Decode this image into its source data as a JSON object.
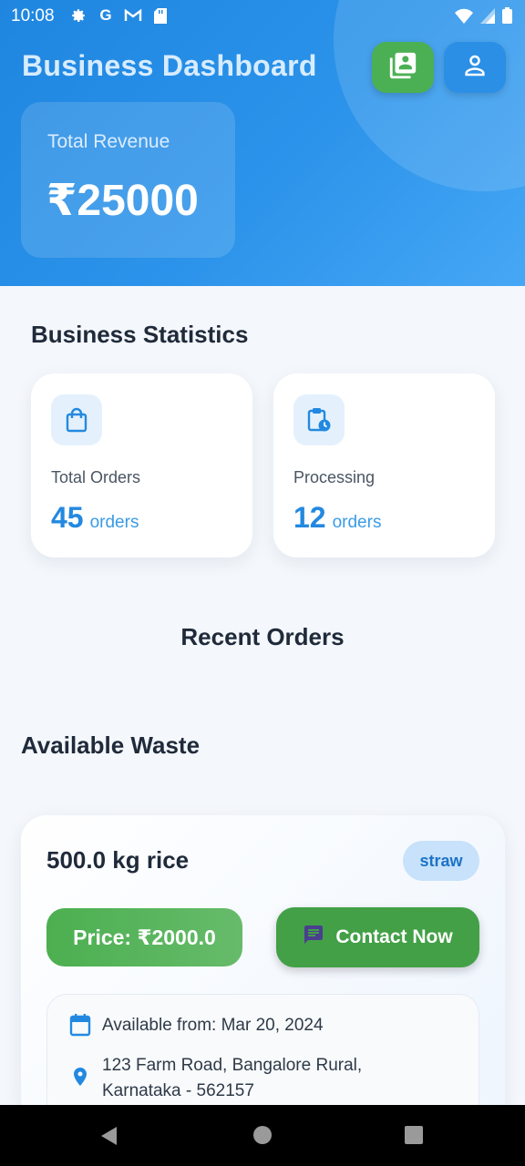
{
  "status_bar": {
    "time": "10:08",
    "icons": [
      "settings-icon",
      "google-icon",
      "gmail-icon",
      "sd-card-icon"
    ],
    "right_icons": [
      "wifi-icon",
      "signal-icon",
      "battery-icon"
    ]
  },
  "header": {
    "title": "Business Dashboard",
    "buttons": [
      "portfolio-icon",
      "profile-icon"
    ],
    "revenue_label": "Total Revenue",
    "revenue_value": "₹25000",
    "colors": {
      "primary": "#2389e0",
      "accent_green": "#4caf50"
    }
  },
  "statistics": {
    "title": "Business Statistics",
    "cards": [
      {
        "label": "Total Orders",
        "value": "45",
        "unit": "orders",
        "icon": "shopping-bag-icon"
      },
      {
        "label": "Processing",
        "value": "12",
        "unit": "orders",
        "icon": "clipboard-clock-icon"
      }
    ]
  },
  "recent_orders": {
    "title": "Recent Orders"
  },
  "available_waste": {
    "title": "Available Waste",
    "item": {
      "name": "500.0 kg rice",
      "tag": "straw",
      "price": "Price: ₹2000.0",
      "contact_label": "Contact Now",
      "available_from": "Available from: Mar 20, 2024",
      "address_line1": "123 Farm Road, Bangalore Rural,",
      "address_line2": "Karnataka - 562157"
    }
  }
}
